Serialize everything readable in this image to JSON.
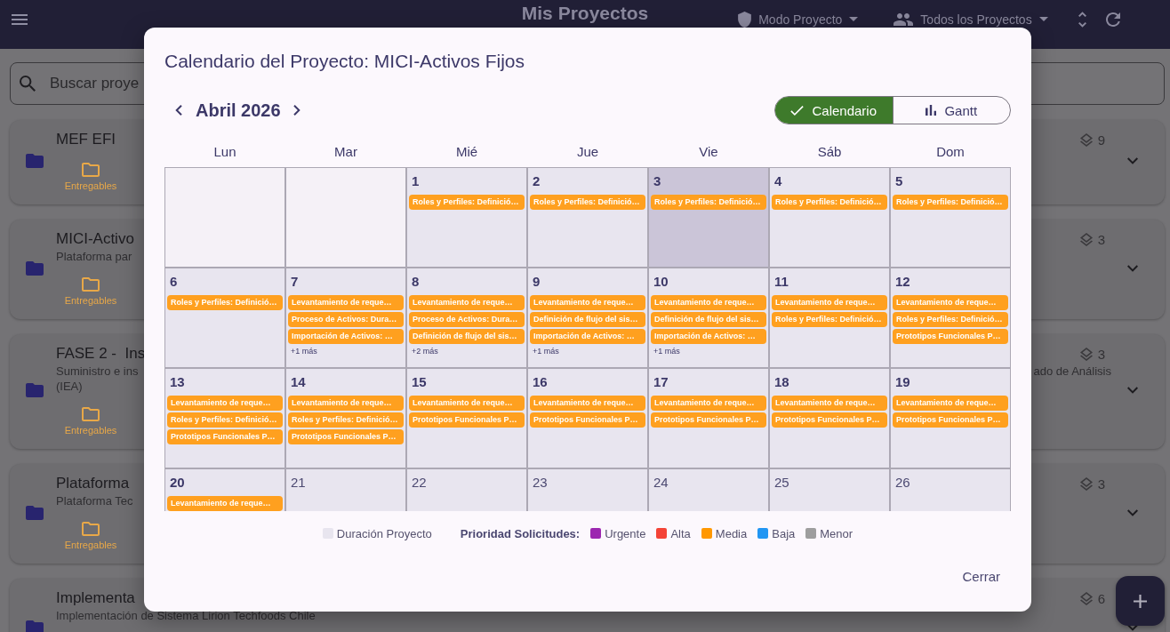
{
  "app_bar": {
    "title": "Mis Proyectos",
    "mode_menu": "Modo Proyecto",
    "project_filter": "Todos los Proyectos"
  },
  "search": {
    "placeholder": "Buscar proye"
  },
  "projects": [
    {
      "title": "MEF EFI",
      "count": "9",
      "deliverables": "Entregables"
    },
    {
      "title": "MICI-Activo",
      "subtitle_lines": [
        "Plataforma par"
      ],
      "count": "3",
      "deliverables": "Entregables"
    },
    {
      "title": "FASE 2 -  Ins",
      "subtitle_lines": [
        "Suministro e ins",
        "(IEA)"
      ],
      "subtitle_fragment": "ado de Análisis",
      "count": "3",
      "deliverables": "Entregables"
    },
    {
      "title": "Plataforma",
      "subtitle_lines": [
        "Plataforma Tec"
      ],
      "count": "3",
      "deliverables": "Entregables"
    },
    {
      "title": "Implementa",
      "subtitle_lines": [
        "Implementación de Sistema Lirion Techfoods Chile"
      ],
      "count": "6"
    }
  ],
  "dialog": {
    "title": "Calendario del Proyecto: MICI-Activos Fijos",
    "month_label": "Abril 2026",
    "view_toggle": [
      {
        "label": "Calendario",
        "selected": true
      },
      {
        "label": "Gantt",
        "selected": false
      }
    ],
    "weekdays": [
      "Lun",
      "Mar",
      "Mié",
      "Jue",
      "Vie",
      "Sáb",
      "Dom"
    ],
    "weeks": [
      {
        "days": [
          {
            "kind": "blank",
            "today": false
          },
          {
            "kind": "blank",
            "today": false
          },
          {
            "kind": "day",
            "number": "1",
            "today": false,
            "events": [
              {
                "label": "Roles y Perfiles: Definició…",
                "color": "#ffa01f"
              }
            ]
          },
          {
            "kind": "day",
            "number": "2",
            "today": false,
            "events": [
              {
                "label": "Roles y Perfiles: Definició…",
                "color": "#ffa01f"
              }
            ]
          },
          {
            "kind": "day",
            "number": "3",
            "today": true,
            "events": [
              {
                "label": "Roles y Perfiles: Definició…",
                "color": "#ffa01f"
              }
            ]
          },
          {
            "kind": "day",
            "number": "4",
            "today": false,
            "events": [
              {
                "label": "Roles y Perfiles: Definició…",
                "color": "#ffa01f"
              }
            ]
          },
          {
            "kind": "day",
            "number": "5",
            "today": false,
            "events": [
              {
                "label": "Roles y Perfiles: Definició…",
                "color": "#ffa01f"
              }
            ]
          }
        ]
      },
      {
        "days": [
          {
            "kind": "day",
            "number": "6",
            "today": false,
            "events": [
              {
                "label": "Roles y Perfiles: Definició…",
                "color": "#ffa01f"
              }
            ]
          },
          {
            "kind": "day",
            "number": "7",
            "today": false,
            "events": [
              {
                "label": "Levantamiento de reque…",
                "color": "#ffa01f"
              },
              {
                "label": "Proceso de Activos: Dura…",
                "color": "#ffa01f"
              },
              {
                "label": "Importación de Activos: …",
                "color": "#ffa01f"
              }
            ],
            "more": "+1 más"
          },
          {
            "kind": "day",
            "number": "8",
            "today": false,
            "events": [
              {
                "label": "Levantamiento de reque…",
                "color": "#ffa01f"
              },
              {
                "label": "Proceso de Activos: Dura…",
                "color": "#ffa01f"
              },
              {
                "label": "Definición de flujo del sis…",
                "color": "#ffa01f"
              }
            ],
            "more": "+2 más"
          },
          {
            "kind": "day",
            "number": "9",
            "today": false,
            "events": [
              {
                "label": "Levantamiento de reque…",
                "color": "#ffa01f"
              },
              {
                "label": "Definición de flujo del sis…",
                "color": "#ffa01f"
              },
              {
                "label": "Importación de Activos: …",
                "color": "#ffa01f"
              }
            ],
            "more": "+1 más"
          },
          {
            "kind": "day",
            "number": "10",
            "today": false,
            "events": [
              {
                "label": "Levantamiento de reque…",
                "color": "#ffa01f"
              },
              {
                "label": "Definición de flujo del sis…",
                "color": "#ffa01f"
              },
              {
                "label": "Importación de Activos: …",
                "color": "#ffa01f"
              }
            ],
            "more": "+1 más"
          },
          {
            "kind": "day",
            "number": "11",
            "today": false,
            "events": [
              {
                "label": "Levantamiento de reque…",
                "color": "#ffa01f"
              },
              {
                "label": "Roles y Perfiles: Definició…",
                "color": "#ffa01f"
              }
            ]
          },
          {
            "kind": "day",
            "number": "12",
            "today": false,
            "events": [
              {
                "label": "Levantamiento de reque…",
                "color": "#ffa01f"
              },
              {
                "label": "Roles y Perfiles: Definició…",
                "color": "#ffa01f"
              },
              {
                "label": "Prototipos Funcionales P…",
                "color": "#ffa01f"
              }
            ]
          }
        ]
      },
      {
        "days": [
          {
            "kind": "day",
            "number": "13",
            "today": false,
            "events": [
              {
                "label": "Levantamiento de reque…",
                "color": "#ffa01f"
              },
              {
                "label": "Roles y Perfiles: Definició…",
                "color": "#ffa01f"
              },
              {
                "label": "Prototipos Funcionales P…",
                "color": "#ffa01f"
              }
            ]
          },
          {
            "kind": "day",
            "number": "14",
            "today": false,
            "events": [
              {
                "label": "Levantamiento de reque…",
                "color": "#ffa01f"
              },
              {
                "label": "Roles y Perfiles: Definició…",
                "color": "#ffa01f"
              },
              {
                "label": "Prototipos Funcionales P…",
                "color": "#ffa01f"
              }
            ]
          },
          {
            "kind": "day",
            "number": "15",
            "today": false,
            "events": [
              {
                "label": "Levantamiento de reque…",
                "color": "#ffa01f"
              },
              {
                "label": "Prototipos Funcionales P…",
                "color": "#ffa01f"
              }
            ]
          },
          {
            "kind": "day",
            "number": "16",
            "today": false,
            "events": [
              {
                "label": "Levantamiento de reque…",
                "color": "#ffa01f"
              },
              {
                "label": "Prototipos Funcionales P…",
                "color": "#ffa01f"
              }
            ]
          },
          {
            "kind": "day",
            "number": "17",
            "today": false,
            "events": [
              {
                "label": "Levantamiento de reque…",
                "color": "#ffa01f"
              },
              {
                "label": "Prototipos Funcionales P…",
                "color": "#ffa01f"
              }
            ]
          },
          {
            "kind": "day",
            "number": "18",
            "today": false,
            "events": [
              {
                "label": "Levantamiento de reque…",
                "color": "#ffa01f"
              },
              {
                "label": "Prototipos Funcionales P…",
                "color": "#ffa01f"
              }
            ]
          },
          {
            "kind": "day",
            "number": "19",
            "today": false,
            "events": [
              {
                "label": "Levantamiento de reque…",
                "color": "#ffa01f"
              },
              {
                "label": "Prototipos Funcionales P…",
                "color": "#ffa01f"
              }
            ]
          }
        ]
      },
      {
        "days": [
          {
            "kind": "day",
            "number": "20",
            "today": false,
            "events": [
              {
                "label": "Levantamiento de reque…",
                "color": "#ffa01f"
              }
            ]
          },
          {
            "kind": "day",
            "number": "21",
            "today": false
          },
          {
            "kind": "day",
            "number": "22",
            "today": false
          },
          {
            "kind": "day",
            "number": "23",
            "today": false
          },
          {
            "kind": "day",
            "number": "24",
            "today": false
          },
          {
            "kind": "day",
            "number": "25",
            "today": false
          },
          {
            "kind": "day",
            "number": "26",
            "today": false
          }
        ]
      }
    ],
    "legend": {
      "duration": {
        "label": "Duración Proyecto",
        "color": "#e8e5ef"
      },
      "priority_title": "Prioridad Solicitudes:",
      "priorities": [
        {
          "label": "Urgente",
          "color": "#9c27b0"
        },
        {
          "label": "Alta",
          "color": "#f44336"
        },
        {
          "label": "Media",
          "color": "#ff9800"
        },
        {
          "label": "Baja",
          "color": "#2196f3"
        },
        {
          "label": "Menor",
          "color": "#9e9e9e"
        }
      ]
    },
    "close_button": "Cerrar"
  }
}
